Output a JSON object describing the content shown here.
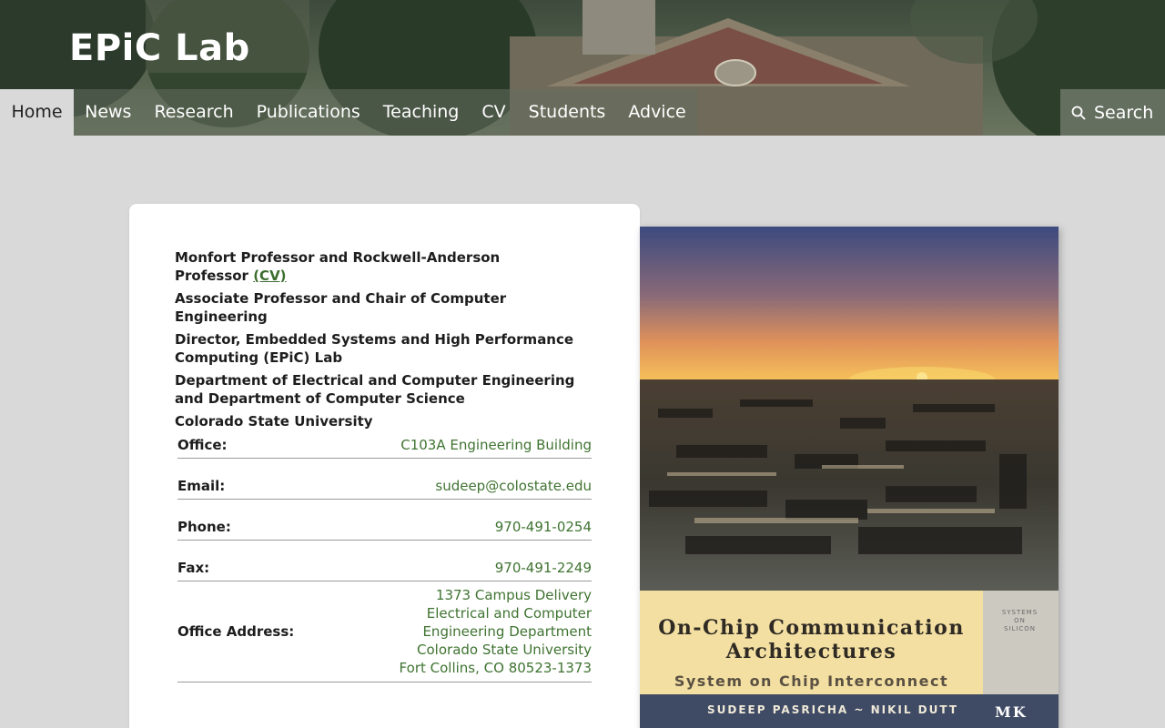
{
  "site": {
    "title": "EPiC Lab"
  },
  "nav": {
    "items": [
      {
        "label": "Home",
        "active": true
      },
      {
        "label": "News"
      },
      {
        "label": "Research"
      },
      {
        "label": "Publications"
      },
      {
        "label": "Teaching"
      },
      {
        "label": "CV"
      },
      {
        "label": "Students"
      },
      {
        "label": "Advice"
      }
    ],
    "search_label": "Search",
    "search_icon": "search-icon"
  },
  "profile": {
    "titles": [
      "Monfort Professor and Rockwell-Anderson Professor",
      "Associate Professor and Chair of Computer Engineering",
      "Director, Embedded Systems and High Performance Computing (EPiC) Lab",
      "Department of Electrical and Computer Engineering and Department of Computer Science",
      "Colorado State University"
    ],
    "cv_link": "(CV)",
    "contact": {
      "office_label": "Office:",
      "office": "C103A Engineering Building",
      "email_label": "Email:",
      "email": "sudeep@colostate.edu",
      "phone_label": "Phone:",
      "phone": "970-491-0254",
      "fax_label": "Fax:",
      "fax": "970-491-2249",
      "address_label": "Office Address:",
      "address_lines": [
        "1373 Campus Delivery",
        "Electrical and Computer",
        "Engineering Department",
        "Colorado State University",
        "Fort Collins, CO 80523-1373"
      ]
    }
  },
  "book": {
    "title_line1": "On-Chip Communication",
    "title_line2": "Architectures",
    "subtitle": "System on Chip Interconnect",
    "authors": "SUDEEP PASRICHA  ~  NIKIL DUTT",
    "series": [
      "SYSTEMS",
      "ON",
      "SILICON"
    ],
    "publisher_logo": "MK"
  },
  "colors": {
    "link_green": "#3f7331",
    "page_bg": "#d9d9d9",
    "book_band": "#f2dfa1",
    "book_author_bar": "#3f4a64"
  }
}
